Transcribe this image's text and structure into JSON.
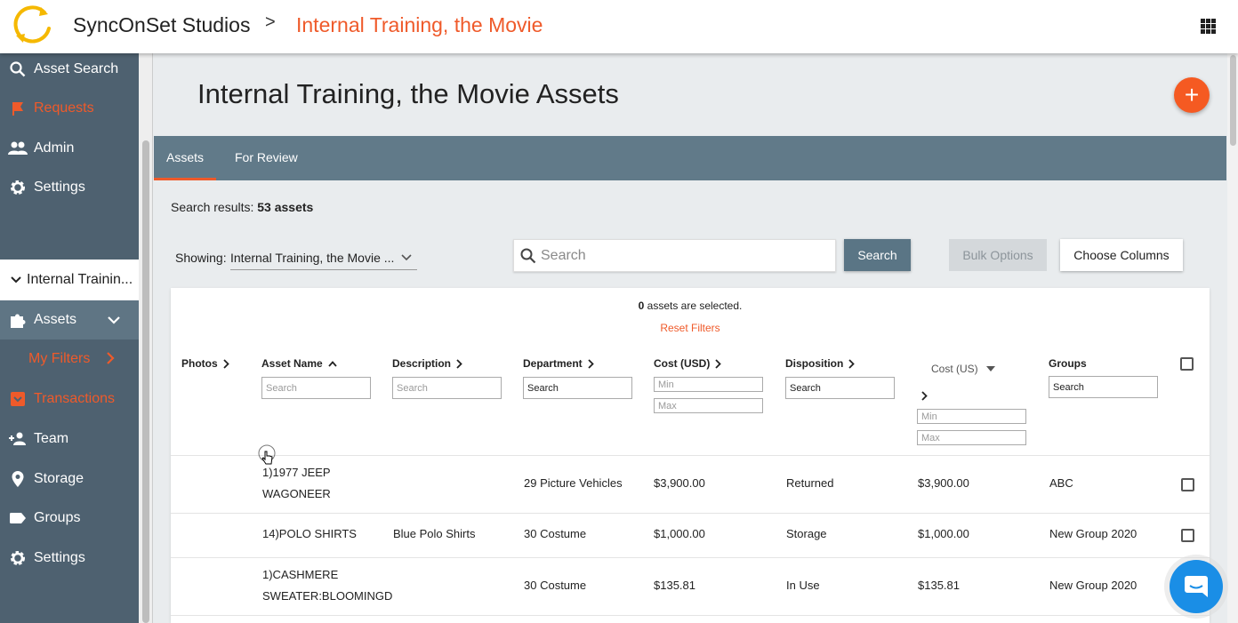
{
  "topbar": {
    "org_name": "SyncOnSet Studios",
    "separator": ">",
    "project_name": "Internal Training, the Movie",
    "brand_color": "#ef5a2a"
  },
  "sidebar": {
    "top_items": [
      {
        "label": "Asset Search",
        "icon": "search-icon"
      },
      {
        "label": "Requests",
        "icon": "flag-icon"
      },
      {
        "label": "Admin",
        "icon": "people-icon"
      },
      {
        "label": "Settings",
        "icon": "gear-icon"
      }
    ],
    "project_label": "Internal Trainin...",
    "project_items": [
      {
        "label": "Assets",
        "icon": "puzzle-icon"
      },
      {
        "label": "My Filters",
        "icon": "chevron-right-icon"
      },
      {
        "label": "Transactions",
        "icon": "inbox-icon"
      },
      {
        "label": "Team",
        "icon": "add-person-icon"
      },
      {
        "label": "Storage",
        "icon": "location-pin-icon"
      },
      {
        "label": "Groups",
        "icon": "tag-icon"
      },
      {
        "label": "Settings",
        "icon": "gear-icon"
      }
    ]
  },
  "main": {
    "title": "Internal Training, the Movie Assets",
    "fab_label": "+",
    "tabs": [
      {
        "label": "Assets",
        "active": true
      },
      {
        "label": "For Review",
        "active": false
      }
    ],
    "results_prefix": "Search results:",
    "results_count": "53 assets",
    "showing_label": "Showing:",
    "showing_value": "Internal Training, the Movie ...",
    "search_placeholder": "Search",
    "search_button": "Search",
    "bulk_button": "Bulk Options",
    "columns_button": "Choose Columns"
  },
  "table": {
    "selected_count": "0",
    "selected_text": "assets are selected.",
    "reset_filters": "Reset Filters",
    "columns": [
      {
        "label": "Photos"
      },
      {
        "label": "Asset Name"
      },
      {
        "label": "Description"
      },
      {
        "label": "Department"
      },
      {
        "label": "Cost (USD)"
      },
      {
        "label": "Disposition"
      },
      {
        "label": "Cost (US)"
      },
      {
        "label": "Groups"
      }
    ],
    "filters": {
      "asset_name_placeholder": "Search",
      "description_placeholder": "Search",
      "department_placeholder": "Search",
      "cost_min_placeholder": "Min",
      "cost_max_placeholder": "Max",
      "disposition_placeholder": "Search",
      "cost_us_min_placeholder": "Min",
      "cost_us_max_placeholder": "Max",
      "groups_placeholder": "Search"
    },
    "rows": [
      {
        "asset_name_1": "1)1977 JEEP",
        "asset_name_2": "WAGONEER",
        "description": "",
        "department": "29 Picture Vehicles",
        "cost_usd": "$3,900.00",
        "disposition": "Returned",
        "cost_us": "$3,900.00",
        "groups": "ABC"
      },
      {
        "asset_name_1": "14)POLO SHIRTS",
        "asset_name_2": "",
        "description": "Blue Polo Shirts",
        "department": "30 Costume",
        "cost_usd": "$1,000.00",
        "disposition": "Storage",
        "cost_us": "$1,000.00",
        "groups": "New Group 2020"
      },
      {
        "asset_name_1": "1)CASHMERE",
        "asset_name_2": "SWEATER:BLOOMINGD",
        "description": "",
        "department": "30 Costume",
        "cost_usd": "$135.81",
        "disposition": "In Use",
        "cost_us": "$135.81",
        "groups": "New Group 2020"
      }
    ]
  }
}
